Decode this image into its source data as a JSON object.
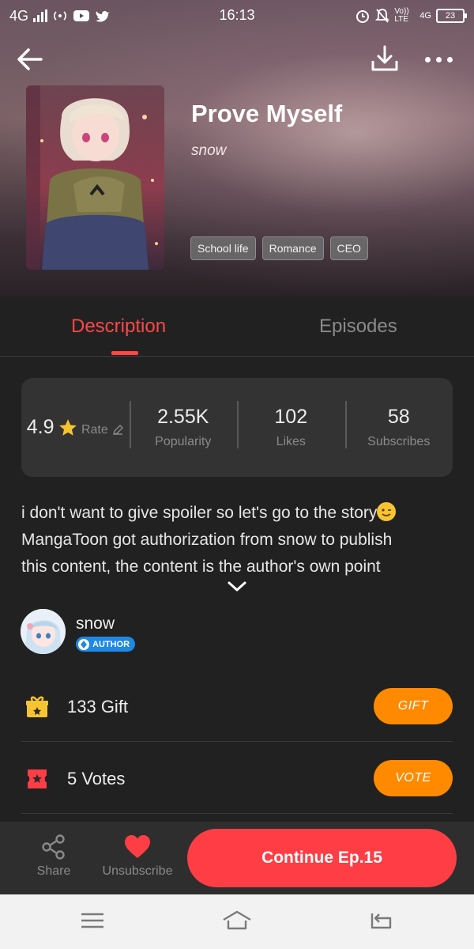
{
  "status_bar": {
    "network": "4G",
    "time": "16:13",
    "volte": "Vo)) LTE",
    "net_right": "4G",
    "battery": "23"
  },
  "book": {
    "title": "Prove Myself",
    "author": "snow",
    "tags": [
      "School life",
      "Romance",
      "CEO"
    ]
  },
  "tabs": {
    "description": "Description",
    "episodes": "Episodes"
  },
  "stats": {
    "rating_value": "4.9",
    "rating_label": "Rate",
    "popularity_value": "2.55K",
    "popularity_label": "Popularity",
    "likes_value": "102",
    "likes_label": "Likes",
    "subscribes_value": "58",
    "subscribes_label": "Subscribes"
  },
  "description": {
    "line1": "i don't want to give spoiler so let's go to the story",
    "line2": "MangaToon got authorization from snow to publish",
    "line3": "this content, the content is the author's own point"
  },
  "author": {
    "name": "snow",
    "badge": "AUTHOR"
  },
  "gift": {
    "text": "133  Gift",
    "button": "GIFT"
  },
  "votes": {
    "text": "5  Votes",
    "button": "VOTE"
  },
  "bottom_bar": {
    "share": "Share",
    "unsubscribe": "Unsubscribe",
    "continue": "Continue Ep.15"
  },
  "colors": {
    "accent": "#fe3d45",
    "orange": "#ff8a00",
    "star": "#f7c431",
    "author_badge": "#1e88e5"
  },
  "icons": [
    "back-arrow-icon",
    "download-icon",
    "more-icon",
    "star-icon",
    "pencil-icon",
    "chevron-down-icon",
    "gift-icon",
    "ticket-icon",
    "share-icon",
    "heart-icon",
    "menu-icon",
    "home-icon",
    "return-icon"
  ]
}
